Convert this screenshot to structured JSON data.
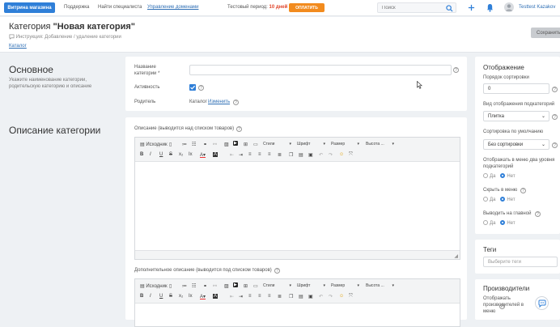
{
  "topbar": {
    "store_button": "Витрина магазина",
    "nav": [
      "Поддержка",
      "Найти специалиста",
      "Управление доменами"
    ],
    "trial_prefix": "Тестовый период:",
    "trial_days": "10 дней",
    "pay_button": "ОПЛАТИТЬ",
    "search_placeholder": "Поиск",
    "user_name": "Testtest Kazakov"
  },
  "header": {
    "title_prefix": "Категория ",
    "title_name": "\"Новая категория\"",
    "help_text": "Инструкция: Добавление / удаление категории",
    "catalog_link": "Каталог",
    "save_button": "Сохранить"
  },
  "basic": {
    "title": "Основное",
    "desc": "Укажите наименование категории, родительскую категорию и описание",
    "name_label": "Название категории *",
    "name_value": "",
    "active_label": "Активность",
    "parent_label": "Родитель",
    "parent_value": "Каталог",
    "parent_change": "Изменить"
  },
  "description": {
    "title": "Описание категории",
    "editor1_label": "Описание (выводится над списком товаров)",
    "editor2_label": "Дополнительное описание (выводится под списком товаров)",
    "source_label": "Исходник",
    "styles_label": "Стили",
    "font_label": "Шрифт",
    "size_label": "Размер",
    "height_label": "Высота ..."
  },
  "display": {
    "title": "Отображение",
    "sort_label": "Порядок сортировки",
    "sort_value": "0",
    "view_label": "Вид отображения подкатегорий",
    "view_value": "Плитка",
    "default_sort_label": "Сортировка по умолчанию",
    "default_sort_value": "Без сортировки",
    "twolevel_label": "Отображать в меню два уровня подкатегорий",
    "hide_label": "Скрыть в меню",
    "main_label": "Выводить на главной",
    "yes": "Да",
    "no": "Нет"
  },
  "tags": {
    "title": "Теги",
    "placeholder": "Выберите теги"
  },
  "manufacturers": {
    "title": "Производители",
    "show_label": "Отображать производителей в меню"
  }
}
